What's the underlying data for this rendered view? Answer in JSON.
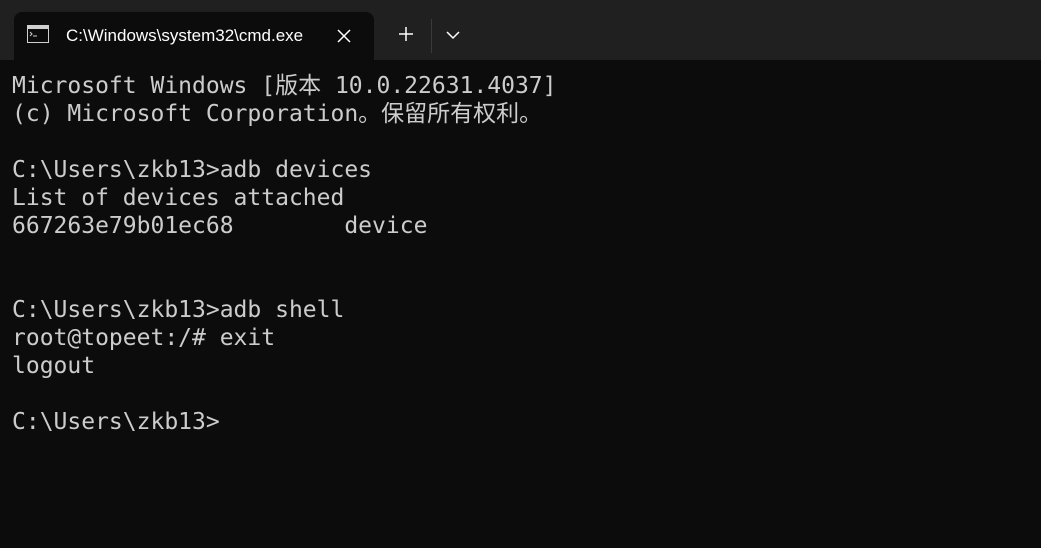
{
  "tab": {
    "title": "C:\\Windows\\system32\\cmd.exe",
    "icon": "cmd-icon"
  },
  "titlebar": {
    "close_icon": "close-icon",
    "new_tab_icon": "plus-icon",
    "dropdown_icon": "chevron-down-icon"
  },
  "terminal": {
    "lines": [
      "Microsoft Windows [版本 10.0.22631.4037]",
      "(c) Microsoft Corporation。保留所有权利。",
      "",
      "C:\\Users\\zkb13>adb devices",
      "List of devices attached",
      "667263e79b01ec68        device",
      "",
      "",
      "C:\\Users\\zkb13>adb shell",
      "root@topeet:/# exit",
      "logout",
      "",
      "C:\\Users\\zkb13>"
    ]
  },
  "colors": {
    "background": "#0c0c0c",
    "titlebar": "#202020",
    "text": "#cccccc"
  }
}
